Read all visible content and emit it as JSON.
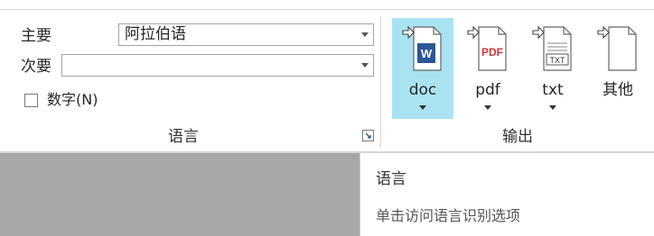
{
  "language_group": {
    "primary_label": "主要",
    "primary_value": "阿拉伯语",
    "secondary_label": "次要",
    "secondary_value": "",
    "numbers_checkbox_label": "数字(N)",
    "numbers_checked": false,
    "group_title": "语言"
  },
  "output_group": {
    "group_title": "输出",
    "buttons": [
      {
        "label": "doc",
        "icon": "word-doc-icon",
        "has_dropdown": true,
        "active": true
      },
      {
        "label": "pdf",
        "icon": "pdf-doc-icon",
        "has_dropdown": true,
        "active": false
      },
      {
        "label": "txt",
        "icon": "txt-doc-icon",
        "has_dropdown": true,
        "active": false
      },
      {
        "label": "其他",
        "icon": "blank-doc-icon",
        "has_dropdown": false,
        "active": false
      }
    ]
  },
  "tooltip": {
    "title": "语言",
    "description": "单击访问语言识别选项"
  },
  "colors": {
    "active_button_bg": "#a9e3f2",
    "word_blue": "#2b5797",
    "pdf_red": "#d13438",
    "grey_panel": "#a8a8a8"
  }
}
